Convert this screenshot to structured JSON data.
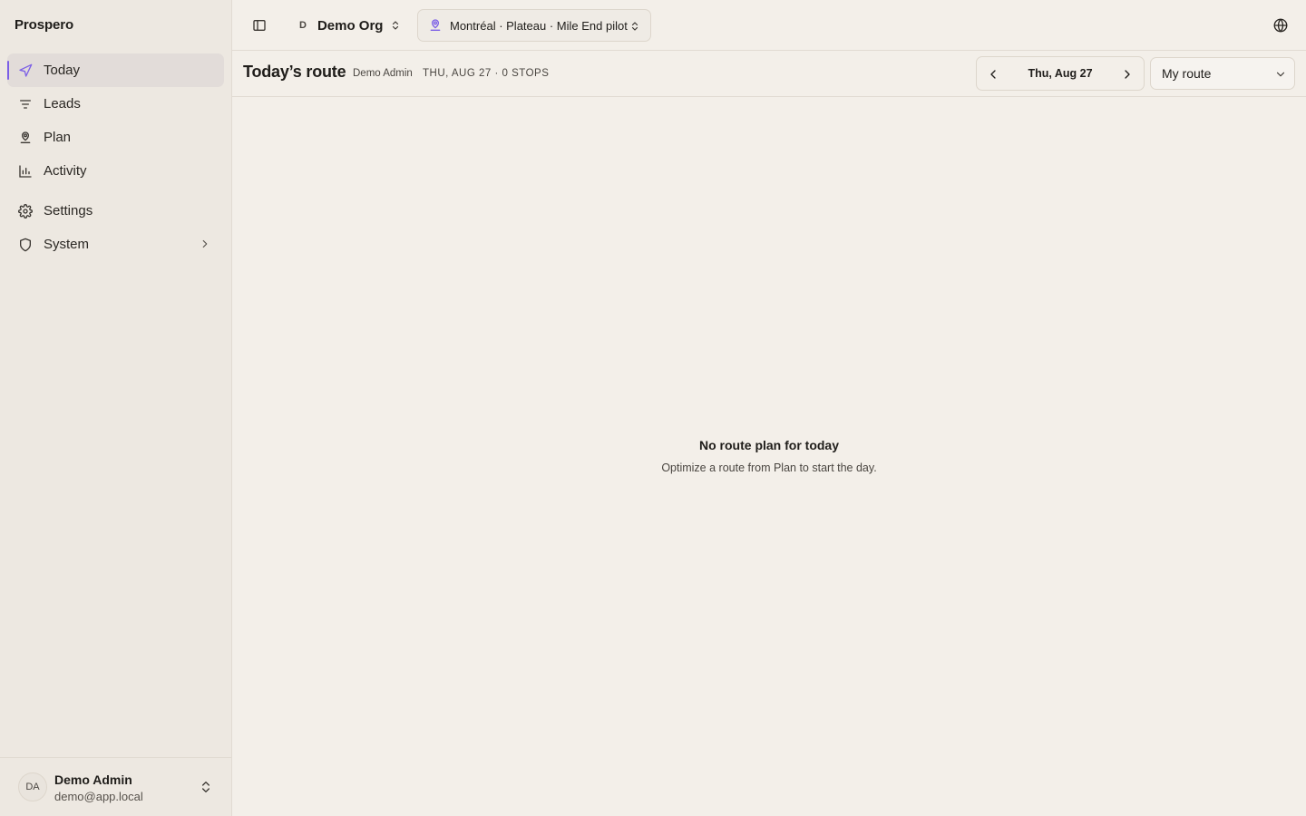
{
  "app": {
    "brand": "Prospero"
  },
  "sidebar": {
    "items": [
      {
        "label": "Today",
        "icon": "navigation-icon",
        "active": true
      },
      {
        "label": "Leads",
        "icon": "filter-lines-icon"
      },
      {
        "label": "Plan",
        "icon": "map-pin-user-icon"
      },
      {
        "label": "Activity",
        "icon": "bar-chart-icon"
      },
      {
        "label": "Settings",
        "icon": "gear-icon"
      },
      {
        "label": "System",
        "icon": "shield-icon",
        "has_submenu": true
      }
    ],
    "user": {
      "initials": "DA",
      "name": "Demo Admin",
      "email": "demo@app.local"
    }
  },
  "topbar": {
    "org_initial": "D",
    "org_name": "Demo Org",
    "territory": "Montréal · Plateau · Mile End pilot"
  },
  "header": {
    "title": "Today’s route",
    "user": "Demo Admin",
    "meta": "THU, AUG 27 · 0 STOPS",
    "date_label": "Thu, Aug 27",
    "route_select_value": "My route"
  },
  "empty_state": {
    "title": "No route plan for today",
    "subtitle": "Optimize a route from Plan to start the day."
  },
  "colors": {
    "accent": "#7c5fe6",
    "background": "#f3efe9",
    "sidebar": "#ede8e1"
  }
}
